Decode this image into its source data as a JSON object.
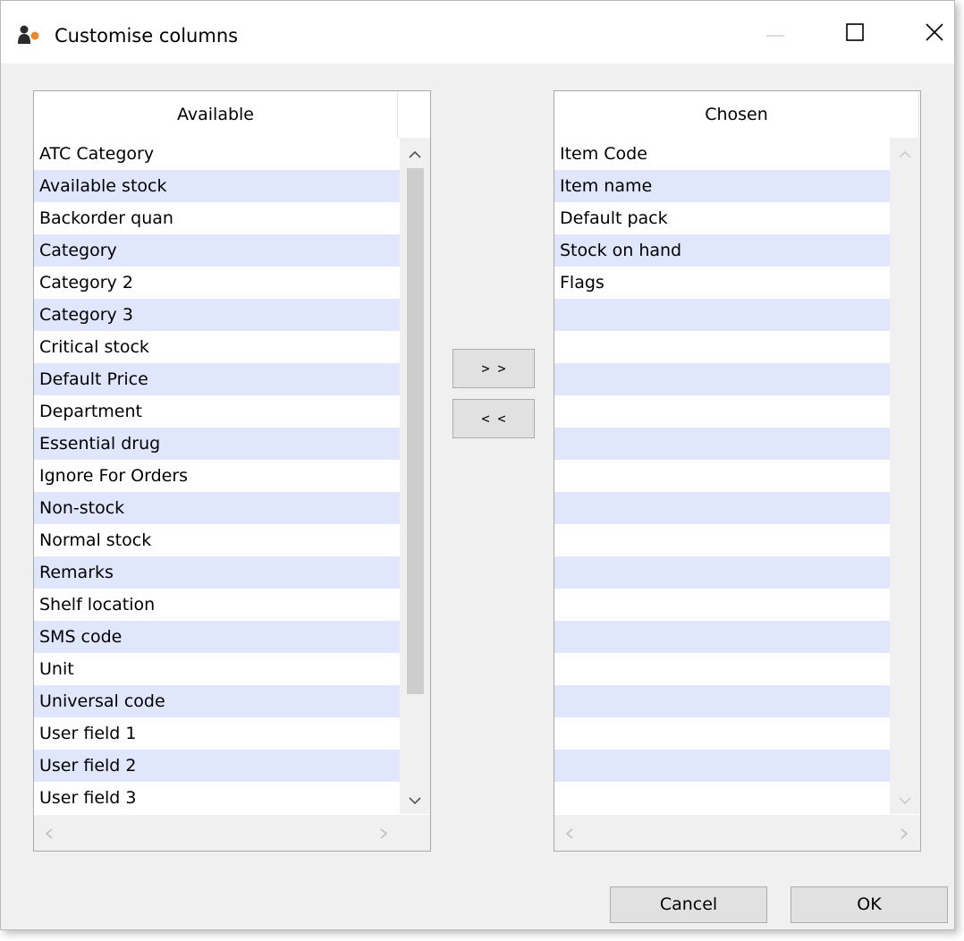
{
  "window": {
    "title": "Customise columns",
    "icon": "app-people-icon",
    "controls": [
      "minimize-icon",
      "maximize-icon",
      "close-icon"
    ]
  },
  "available": {
    "header": "Available",
    "items": [
      "ATC Category",
      "Available stock",
      "Backorder quan",
      "Category",
      "Category 2",
      "Category 3",
      "Critical stock",
      "Default Price",
      "Department",
      "Essential drug",
      "Ignore For Orders",
      "Non-stock",
      "Normal stock",
      "Remarks",
      "Shelf location",
      "SMS code",
      "Unit",
      "Universal code",
      "User field 1",
      "User field 2",
      "User field 3"
    ]
  },
  "chosen": {
    "header": "Chosen",
    "items": [
      "Item Code",
      "Item name",
      "Default pack",
      "Stock on hand",
      "Flags",
      "",
      "",
      "",
      "",
      "",
      "",
      "",
      "",
      "",
      "",
      "",
      "",
      "",
      "",
      "",
      ""
    ]
  },
  "buttons": {
    "add": "> >",
    "remove": "< <",
    "cancel": "Cancel",
    "ok": "OK"
  },
  "colors": {
    "row_alt": "#e0e6fc",
    "scroll_thumb": "#cdcdcd",
    "button_face": "#e1e1e1"
  }
}
